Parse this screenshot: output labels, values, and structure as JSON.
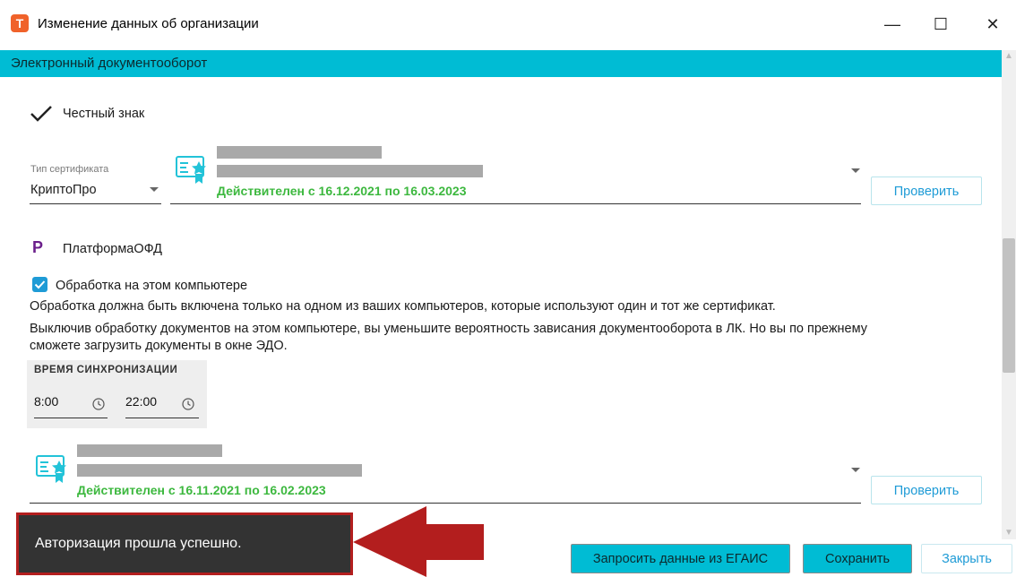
{
  "window": {
    "title": "Изменение данных об организации",
    "app_icon_letter": "Т",
    "minimize": "—",
    "maximize": "☐",
    "close": "✕"
  },
  "section": {
    "title": "Электронный документооборот"
  },
  "chestny_znak": {
    "label": "Честный знак",
    "cert_type_label": "Тип сертификата",
    "cert_type_value": "КриптоПро",
    "validity": "Действителен с 16.12.2021 по 16.03.2023",
    "check_button": "Проверить"
  },
  "platforma_ofd": {
    "logo_letter": "P",
    "label": "ПлатформаОФД",
    "processing_checkbox_label": "Обработка на этом компьютере",
    "processing_checked": true,
    "info_line1": "Обработка должна быть включена только на одном из ваших компьютеров, которые используют один и тот же сертификат.",
    "info_line2": "Выключив обработку документов на этом компьютере, вы уменьшите вероятность зависания документооборота в ЛК. Но вы по прежнему",
    "info_line3": "сможете загрузить документы в окне ЭДО.",
    "sync_label": "ВРЕМЯ СИНХРОНИЗАЦИИ",
    "sync_from": "8:00",
    "sync_to": "22:00",
    "validity": "Действителен с 16.11.2021 по 16.02.2023",
    "check_button": "Проверить"
  },
  "toast": {
    "message": "Авторизация прошла успешно."
  },
  "footer": {
    "request_egais": "Запросить данные из ЕГАИС",
    "save": "Сохранить",
    "close": "Закрыть"
  },
  "colors": {
    "accent": "#00bcd4",
    "valid_green": "#3db83f",
    "link_blue": "#1e9bd6",
    "annotation_red": "#b31e1e"
  }
}
